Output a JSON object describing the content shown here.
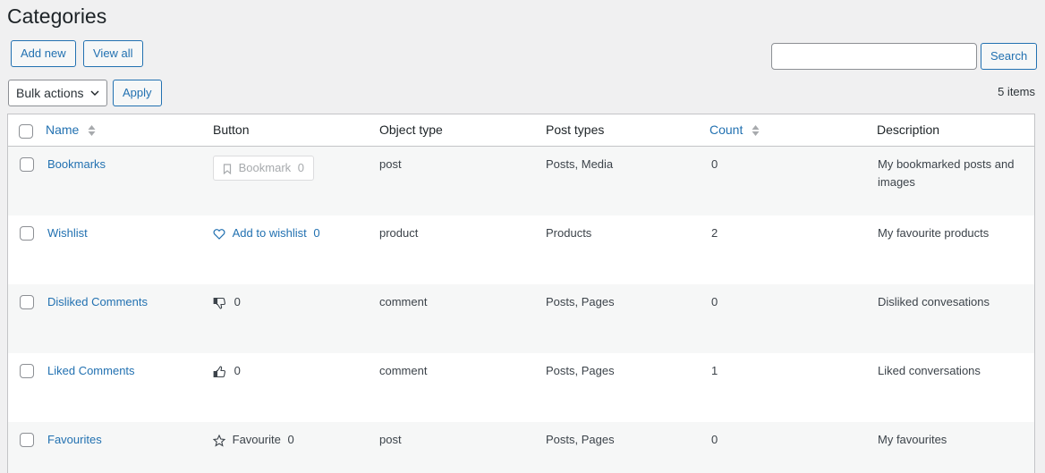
{
  "page": {
    "title": "Categories"
  },
  "toolbar": {
    "add_new": "Add new",
    "view_all": "View all",
    "search_placeholder": "",
    "search_button": "Search",
    "bulk_actions": "Bulk actions",
    "apply": "Apply",
    "items_count": "5 items"
  },
  "table": {
    "columns": {
      "name": "Name",
      "button": "Button",
      "object_type": "Object type",
      "post_types": "Post types",
      "count": "Count",
      "description": "Description"
    },
    "rows": [
      {
        "name": "Bookmarks",
        "button_label": "Bookmark",
        "button_count": "0",
        "button_icon": "bookmark-icon",
        "object_type": "post",
        "post_types": "Posts, Media",
        "count": "0",
        "description_line1": "My bookmarked posts and",
        "description_line2": "images"
      },
      {
        "name": "Wishlist",
        "button_label": "Add to wishlist",
        "button_count": "0",
        "button_icon": "heart-icon",
        "object_type": "product",
        "post_types": "Products",
        "count": "2",
        "description_line1": "My favourite products"
      },
      {
        "name": "Disliked Comments",
        "button_label": "",
        "button_count": "0",
        "button_icon": "thumbs-down-icon",
        "object_type": "comment",
        "post_types": "Posts, Pages",
        "count": "0",
        "description_line1": "Disliked convesations"
      },
      {
        "name": "Liked Comments",
        "button_label": "",
        "button_count": "0",
        "button_icon": "thumbs-up-icon",
        "object_type": "comment",
        "post_types": "Posts, Pages",
        "count": "1",
        "description_line1": "Liked conversations"
      },
      {
        "name": "Favourites",
        "button_label": "Favourite",
        "button_count": "0",
        "button_icon": "star-icon",
        "object_type": "post",
        "post_types": "Posts, Pages",
        "count": "0",
        "description_line1": "My favourites"
      }
    ]
  },
  "colors": {
    "accent": "#2271b1",
    "background": "#f0f0f1",
    "row_alt": "#f6f7f7"
  }
}
